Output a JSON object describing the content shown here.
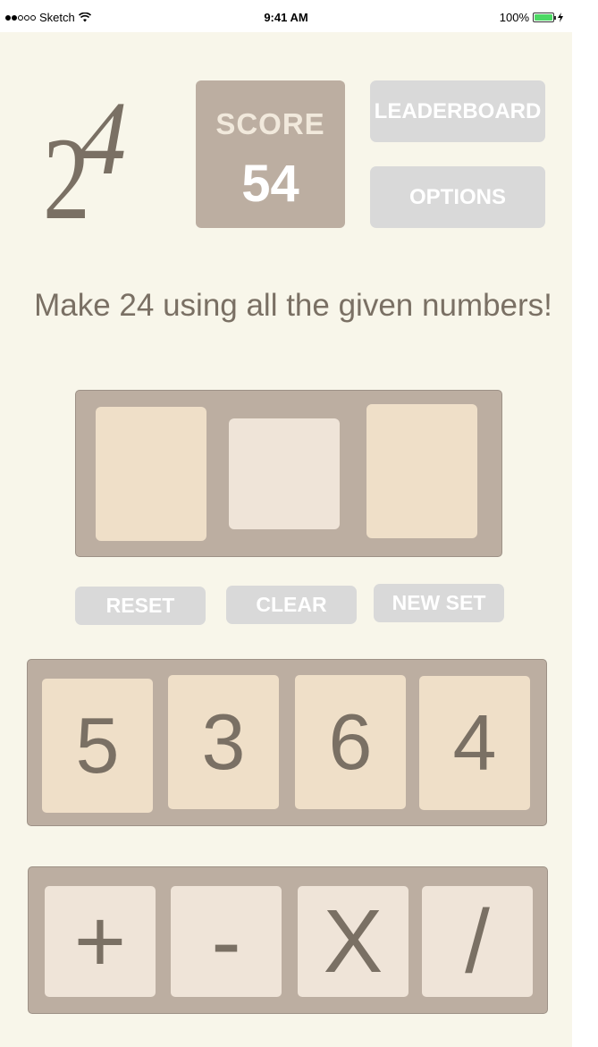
{
  "status_bar": {
    "carrier": "Sketch",
    "time": "9:41 AM",
    "battery_percent": "100%",
    "signal_bars_filled": 2,
    "signal_bars_total": 5
  },
  "logo": {
    "digit_two": "2",
    "digit_four": "4"
  },
  "score": {
    "label": "SCORE",
    "value": "54"
  },
  "nav": {
    "leaderboard_label": "LEADERBOARD",
    "options_label": "OPTIONS"
  },
  "instruction": "Make 24 using all the given numbers!",
  "slots": [
    {
      "color": "#efdfc8"
    },
    {
      "color": "#efe4d8"
    },
    {
      "color": "#efdfc8"
    }
  ],
  "actions": {
    "reset_label": "RESET",
    "clear_label": "CLEAR",
    "new_set_label": "NEW SET"
  },
  "numbers": [
    "5",
    "3",
    "6",
    "4"
  ],
  "operators": [
    "+",
    "-",
    "X",
    "/"
  ],
  "colors": {
    "background": "#f8f6ea",
    "panel": "#bcaea1",
    "tile": "#efdfc8",
    "operator_tile": "#efe4d8",
    "text": "#7a7064",
    "button": "#d9d9d9"
  }
}
